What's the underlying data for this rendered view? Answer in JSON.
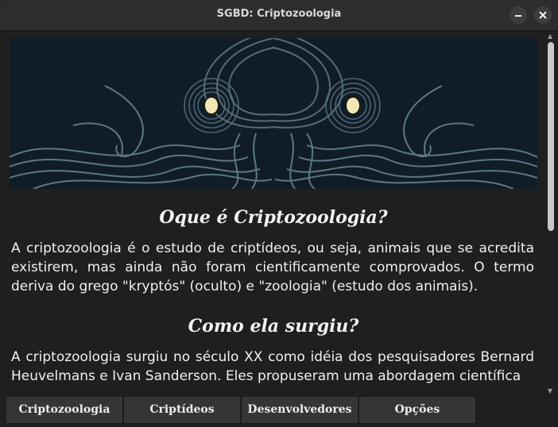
{
  "window": {
    "title": "SGBD: Criptozoologia",
    "minimize_icon": "minimize-icon",
    "close_icon": "close-icon"
  },
  "hero": {
    "image": "octopus-illustration",
    "colors": {
      "background": "#111d26",
      "tentacle": "#5b7683",
      "eye": "#f3e6b6"
    }
  },
  "content": {
    "sections": [
      {
        "heading": "Oque é Criptozoologia?",
        "text": "A criptozoologia é o estudo de criptídeos, ou seja, animais que se acredita existirem, mas ainda não foram cientificamente comprovados. O termo deriva do grego \"kryptós\" (oculto) e \"zoologia\" (estudo dos animais)."
      },
      {
        "heading": "Como ela surgiu?",
        "text": "A criptozoologia surgiu no século XX como idéia dos pesquisadores Bernard Heuvelmans e Ivan Sanderson. Eles propuseram uma abordagem científica"
      }
    ]
  },
  "scrollbar": {
    "up_icon": "arrow-up-icon",
    "down_icon": "arrow-down-icon"
  },
  "tabs": [
    {
      "label": "Criptozoologia"
    },
    {
      "label": "Criptídeos"
    },
    {
      "label": "Desenvolvedores"
    },
    {
      "label": "Opções"
    }
  ]
}
